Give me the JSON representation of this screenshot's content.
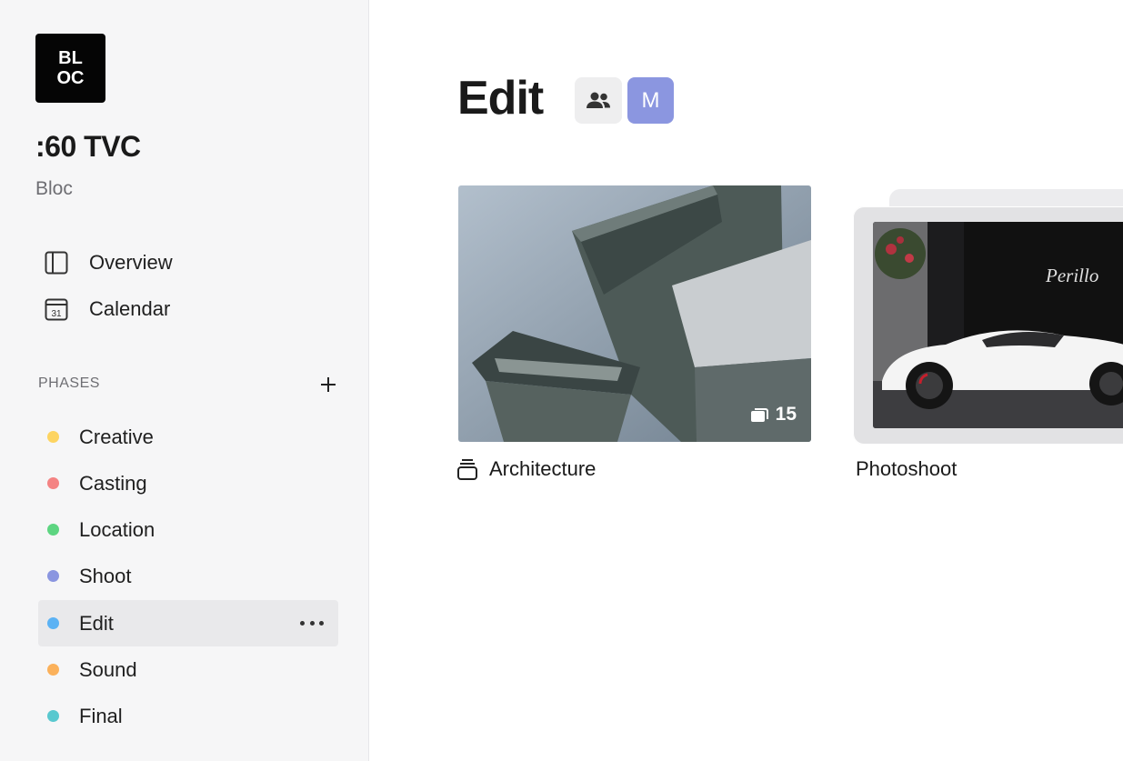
{
  "sidebar": {
    "logo_line1": "BL",
    "logo_line2": "OC",
    "project_title": ":60 TVC",
    "project_subtitle": "Bloc",
    "nav": [
      {
        "label": "Overview",
        "icon": "sidebar-panel-icon"
      },
      {
        "label": "Calendar",
        "icon": "calendar-icon",
        "icon_text": "31"
      }
    ],
    "phases_label": "PHASES",
    "phases": [
      {
        "label": "Creative",
        "color": "#fdd461"
      },
      {
        "label": "Casting",
        "color": "#f48383"
      },
      {
        "label": "Location",
        "color": "#5dd581"
      },
      {
        "label": "Shoot",
        "color": "#8a95e0"
      },
      {
        "label": "Edit",
        "color": "#5bb2f4",
        "active": true
      },
      {
        "label": "Sound",
        "color": "#fbb15b"
      },
      {
        "label": "Final",
        "color": "#59c8cf"
      }
    ]
  },
  "main": {
    "title": "Edit",
    "avatar_initial": "M",
    "avatar_color": "#8b96e0",
    "cards": [
      {
        "label": "Architecture",
        "count": "15",
        "icon": "stack-icon"
      },
      {
        "label": "Photoshoot",
        "sign_text": "Perillo"
      }
    ]
  }
}
